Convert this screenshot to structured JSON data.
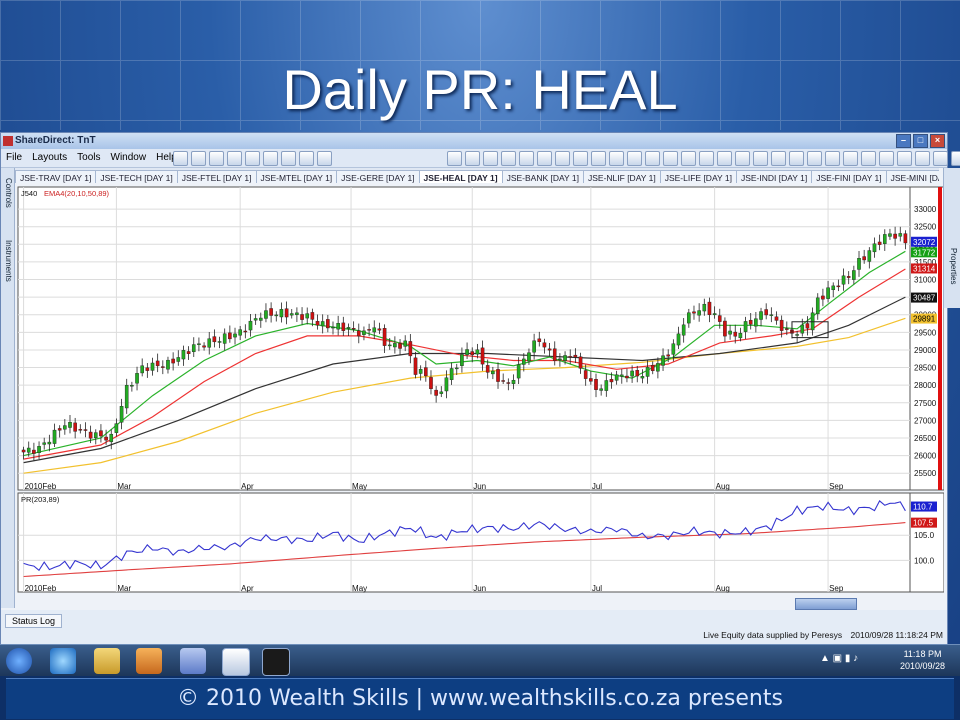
{
  "slide": {
    "title": "Daily PR: HEAL",
    "footer": "© 2010 Wealth Skills | www.wealthskills.co.za presents"
  },
  "app": {
    "window_title": "ShareDirect: TnT",
    "menu": [
      "File",
      "Layouts",
      "Tools",
      "Window",
      "Help"
    ],
    "tabs": [
      {
        "label": "JSE-TRAV [DAY 1]",
        "active": false
      },
      {
        "label": "JSE-TECH [DAY 1]",
        "active": false
      },
      {
        "label": "JSE-FTEL [DAY 1]",
        "active": false
      },
      {
        "label": "JSE-MTEL [DAY 1]",
        "active": false
      },
      {
        "label": "JSE-GERE [DAY 1]",
        "active": false
      },
      {
        "label": "JSE-HEAL [DAY 1]",
        "active": true
      },
      {
        "label": "JSE-BANK [DAY 1]",
        "active": false
      },
      {
        "label": "JSE-NLIF [DAY 1]",
        "active": false
      },
      {
        "label": "JSE-LIFE [DAY 1]",
        "active": false
      },
      {
        "label": "JSE-INDI [DAY 1]",
        "active": false
      },
      {
        "label": "JSE-FINI [DAY 1]",
        "active": false
      },
      {
        "label": "JSE-MINI [DAY 1]",
        "active": false
      }
    ],
    "left_panel": [
      "Controls",
      "Instruments"
    ],
    "right_panel": [
      "Properties"
    ],
    "status_log": "Status Log",
    "supplied_by": "Live Equity data supplied by Peresys",
    "status_time": "2010/09/28 11:18:24 PM",
    "clock_time": "11:18 PM",
    "clock_date": "2010/09/28"
  },
  "colors": {
    "candle_up": "#22aa22",
    "candle_down": "#cc1111",
    "ema_fast": "#2bb32b",
    "ema_mid": "#ee3333",
    "ema_slow": "#333333",
    "ema_long": "#f2c12e",
    "pr_line": "#3535d0",
    "pr_ma": "#e04040"
  },
  "chart_data": [
    {
      "type": "line",
      "instrument": "J540",
      "indicator": "EMA4(20,10,50,89)",
      "x_labels": [
        "2010Feb",
        "Mar",
        "Apr",
        "May",
        "Jun",
        "Jul",
        "Aug",
        "Sep"
      ],
      "x_label_pos": [
        0,
        18,
        42,
        63.5,
        87,
        110,
        134,
        156
      ],
      "ylim": [
        25250,
        33400
      ],
      "y_ticks": [
        25500,
        26000,
        26500,
        27000,
        27500,
        28000,
        28500,
        29000,
        29500,
        30000,
        30500,
        31000,
        31500,
        32000,
        32500,
        33000
      ],
      "n_days": 172,
      "close": [
        {
          "x": 0,
          "y": 26100
        },
        {
          "x": 3,
          "y": 26200
        },
        {
          "x": 8,
          "y": 26900
        },
        {
          "x": 13,
          "y": 26600
        },
        {
          "x": 17,
          "y": 26500
        },
        {
          "x": 20,
          "y": 27900
        },
        {
          "x": 23,
          "y": 28500
        },
        {
          "x": 28,
          "y": 28600
        },
        {
          "x": 33,
          "y": 29100
        },
        {
          "x": 38,
          "y": 29300
        },
        {
          "x": 42,
          "y": 29500
        },
        {
          "x": 46,
          "y": 30000
        },
        {
          "x": 50,
          "y": 30050
        },
        {
          "x": 55,
          "y": 29950
        },
        {
          "x": 58,
          "y": 29700
        },
        {
          "x": 62,
          "y": 29650
        },
        {
          "x": 66,
          "y": 29450
        },
        {
          "x": 68,
          "y": 29700
        },
        {
          "x": 70,
          "y": 29200
        },
        {
          "x": 72,
          "y": 29100
        },
        {
          "x": 74,
          "y": 29200
        },
        {
          "x": 76,
          "y": 28400
        },
        {
          "x": 78,
          "y": 28300
        },
        {
          "x": 80,
          "y": 27600
        },
        {
          "x": 82,
          "y": 28200
        },
        {
          "x": 84,
          "y": 28600
        },
        {
          "x": 86,
          "y": 29000
        },
        {
          "x": 88,
          "y": 28900
        },
        {
          "x": 90,
          "y": 28400
        },
        {
          "x": 92,
          "y": 28200
        },
        {
          "x": 94,
          "y": 28000
        },
        {
          "x": 96,
          "y": 28500
        },
        {
          "x": 98,
          "y": 29000
        },
        {
          "x": 100,
          "y": 29300
        },
        {
          "x": 102,
          "y": 28900
        },
        {
          "x": 104,
          "y": 28700
        },
        {
          "x": 106,
          "y": 28900
        },
        {
          "x": 108,
          "y": 28500
        },
        {
          "x": 110,
          "y": 28000
        },
        {
          "x": 112,
          "y": 27900
        },
        {
          "x": 114,
          "y": 28200
        },
        {
          "x": 117,
          "y": 28300
        },
        {
          "x": 120,
          "y": 28300
        },
        {
          "x": 123,
          "y": 28600
        },
        {
          "x": 126,
          "y": 29100
        },
        {
          "x": 128,
          "y": 29800
        },
        {
          "x": 130,
          "y": 30100
        },
        {
          "x": 132,
          "y": 30200
        },
        {
          "x": 134,
          "y": 30000
        },
        {
          "x": 136,
          "y": 29500
        },
        {
          "x": 138,
          "y": 29400
        },
        {
          "x": 140,
          "y": 29700
        },
        {
          "x": 142,
          "y": 29900
        },
        {
          "x": 144,
          "y": 30100
        },
        {
          "x": 146,
          "y": 29800
        },
        {
          "x": 148,
          "y": 29500
        },
        {
          "x": 150,
          "y": 29500
        },
        {
          "x": 152,
          "y": 29700
        },
        {
          "x": 154,
          "y": 30400
        },
        {
          "x": 156,
          "y": 30700
        },
        {
          "x": 158,
          "y": 30900
        },
        {
          "x": 160,
          "y": 31100
        },
        {
          "x": 162,
          "y": 31500
        },
        {
          "x": 164,
          "y": 31800
        },
        {
          "x": 166,
          "y": 32100
        },
        {
          "x": 168,
          "y": 32300
        },
        {
          "x": 170,
          "y": 32200
        },
        {
          "x": 171,
          "y": 32100
        }
      ],
      "ema_fast": [
        {
          "x": 0,
          "y": 26000
        },
        {
          "x": 15,
          "y": 26500
        },
        {
          "x": 25,
          "y": 27700
        },
        {
          "x": 35,
          "y": 28700
        },
        {
          "x": 45,
          "y": 29400
        },
        {
          "x": 55,
          "y": 29750
        },
        {
          "x": 65,
          "y": 29550
        },
        {
          "x": 75,
          "y": 29100
        },
        {
          "x": 80,
          "y": 28600
        },
        {
          "x": 88,
          "y": 28700
        },
        {
          "x": 95,
          "y": 28550
        },
        {
          "x": 102,
          "y": 28800
        },
        {
          "x": 110,
          "y": 28400
        },
        {
          "x": 118,
          "y": 28200
        },
        {
          "x": 126,
          "y": 28800
        },
        {
          "x": 134,
          "y": 29700
        },
        {
          "x": 142,
          "y": 29700
        },
        {
          "x": 150,
          "y": 29600
        },
        {
          "x": 156,
          "y": 30300
        },
        {
          "x": 164,
          "y": 31200
        },
        {
          "x": 171,
          "y": 31800
        }
      ],
      "ema_mid": [
        {
          "x": 0,
          "y": 25900
        },
        {
          "x": 15,
          "y": 26300
        },
        {
          "x": 25,
          "y": 27100
        },
        {
          "x": 35,
          "y": 28100
        },
        {
          "x": 45,
          "y": 28900
        },
        {
          "x": 55,
          "y": 29400
        },
        {
          "x": 65,
          "y": 29400
        },
        {
          "x": 75,
          "y": 29150
        },
        {
          "x": 85,
          "y": 28850
        },
        {
          "x": 95,
          "y": 28700
        },
        {
          "x": 105,
          "y": 28700
        },
        {
          "x": 115,
          "y": 28450
        },
        {
          "x": 125,
          "y": 28600
        },
        {
          "x": 135,
          "y": 29200
        },
        {
          "x": 145,
          "y": 29400
        },
        {
          "x": 153,
          "y": 29600
        },
        {
          "x": 162,
          "y": 30500
        },
        {
          "x": 171,
          "y": 31300
        }
      ],
      "ema_slow": [
        {
          "x": 0,
          "y": 25800
        },
        {
          "x": 15,
          "y": 26200
        },
        {
          "x": 30,
          "y": 27000
        },
        {
          "x": 45,
          "y": 27900
        },
        {
          "x": 60,
          "y": 28600
        },
        {
          "x": 75,
          "y": 28900
        },
        {
          "x": 90,
          "y": 28900
        },
        {
          "x": 105,
          "y": 28800
        },
        {
          "x": 120,
          "y": 28700
        },
        {
          "x": 135,
          "y": 28900
        },
        {
          "x": 150,
          "y": 29200
        },
        {
          "x": 160,
          "y": 29700
        },
        {
          "x": 171,
          "y": 30500
        }
      ],
      "ema_long": [
        {
          "x": 0,
          "y": 25500
        },
        {
          "x": 15,
          "y": 25800
        },
        {
          "x": 30,
          "y": 26400
        },
        {
          "x": 45,
          "y": 27200
        },
        {
          "x": 60,
          "y": 27800
        },
        {
          "x": 75,
          "y": 28200
        },
        {
          "x": 90,
          "y": 28400
        },
        {
          "x": 105,
          "y": 28500
        },
        {
          "x": 120,
          "y": 28650
        },
        {
          "x": 135,
          "y": 28900
        },
        {
          "x": 150,
          "y": 29100
        },
        {
          "x": 160,
          "y": 29350
        },
        {
          "x": 171,
          "y": 29900
        }
      ],
      "price_labels": [
        {
          "value": "32072",
          "bg": "#1a20d0",
          "fg": "#ffffff"
        },
        {
          "value": "31772",
          "bg": "#14a014",
          "fg": "#ffffff"
        },
        {
          "value": "31314",
          "bg": "#d01818",
          "fg": "#ffffff"
        },
        {
          "value": "30487",
          "bg": "#111111",
          "fg": "#ffffff"
        },
        {
          "value": "29891",
          "bg": "#f2c12e",
          "fg": "#000000"
        }
      ]
    },
    {
      "type": "line",
      "indicator": "PR(203,89)",
      "ylim": [
        96.5,
        112
      ],
      "y_ticks": [
        100.0,
        105.0
      ],
      "x_labels": [
        "2010Feb",
        "Mar",
        "Apr",
        "May",
        "Jun",
        "Jul",
        "Aug",
        "Sep"
      ],
      "pr": [
        {
          "x": 0,
          "y": 99
        },
        {
          "x": 5,
          "y": 98.6
        },
        {
          "x": 10,
          "y": 99.5
        },
        {
          "x": 15,
          "y": 98.8
        },
        {
          "x": 20,
          "y": 101.4
        },
        {
          "x": 25,
          "y": 102.5
        },
        {
          "x": 30,
          "y": 101.6
        },
        {
          "x": 35,
          "y": 102.5
        },
        {
          "x": 40,
          "y": 102.7
        },
        {
          "x": 45,
          "y": 104.4
        },
        {
          "x": 50,
          "y": 104.3
        },
        {
          "x": 55,
          "y": 104.0
        },
        {
          "x": 60,
          "y": 105.4
        },
        {
          "x": 65,
          "y": 103.8
        },
        {
          "x": 70,
          "y": 105.3
        },
        {
          "x": 75,
          "y": 106.5
        },
        {
          "x": 80,
          "y": 104.4
        },
        {
          "x": 85,
          "y": 105.9
        },
        {
          "x": 90,
          "y": 106.5
        },
        {
          "x": 95,
          "y": 106.3
        },
        {
          "x": 100,
          "y": 107.3
        },
        {
          "x": 105,
          "y": 106.2
        },
        {
          "x": 110,
          "y": 105.7
        },
        {
          "x": 115,
          "y": 106.3
        },
        {
          "x": 120,
          "y": 104.7
        },
        {
          "x": 125,
          "y": 104.9
        },
        {
          "x": 130,
          "y": 105.8
        },
        {
          "x": 135,
          "y": 105.3
        },
        {
          "x": 140,
          "y": 105.6
        },
        {
          "x": 145,
          "y": 106.9
        },
        {
          "x": 150,
          "y": 109.9
        },
        {
          "x": 155,
          "y": 110.8
        },
        {
          "x": 160,
          "y": 109.9
        },
        {
          "x": 165,
          "y": 110.6
        },
        {
          "x": 168,
          "y": 111.6
        },
        {
          "x": 171,
          "y": 110.7
        }
      ],
      "pr_ma": [
        {
          "x": 0,
          "y": 96.8
        },
        {
          "x": 20,
          "y": 98.1
        },
        {
          "x": 40,
          "y": 99.3
        },
        {
          "x": 60,
          "y": 100.9
        },
        {
          "x": 80,
          "y": 102.4
        },
        {
          "x": 100,
          "y": 103.7
        },
        {
          "x": 120,
          "y": 104.6
        },
        {
          "x": 140,
          "y": 105.3
        },
        {
          "x": 160,
          "y": 106.6
        },
        {
          "x": 171,
          "y": 107.5
        }
      ],
      "value_labels": [
        {
          "value": "110.7",
          "bg": "#1a20d0",
          "fg": "#ffffff"
        },
        {
          "value": "107.5",
          "bg": "#d01818",
          "fg": "#ffffff"
        }
      ]
    }
  ]
}
